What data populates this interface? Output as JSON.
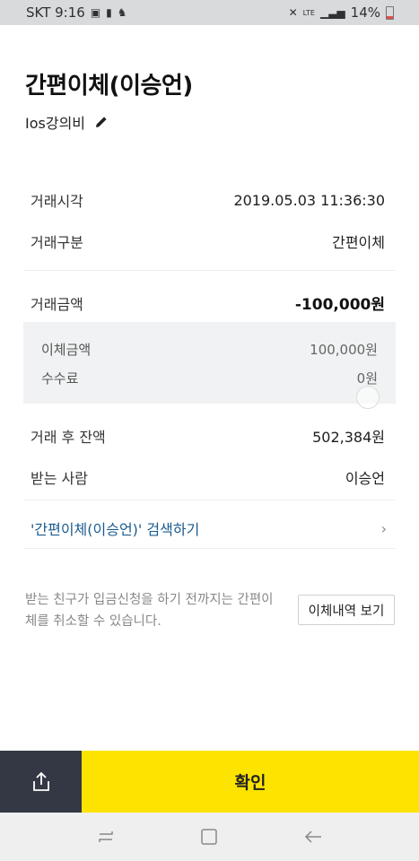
{
  "status_bar": {
    "carrier_time": "SKT 9:16",
    "battery_text": "14%",
    "network": "LTE",
    "icons": [
      "volte-icon",
      "sim-icon",
      "app-icon",
      "mute-icon",
      "signal-icon",
      "battery-icon"
    ]
  },
  "header": {
    "title": "간편이체(이승언)",
    "memo": "Ios강의비"
  },
  "transaction": {
    "time_label": "거래시각",
    "time_value": "2019.05.03 11:36:30",
    "type_label": "거래구분",
    "type_value": "간편이체",
    "amount_label": "거래금액",
    "amount_value": "-100,000원",
    "transfer_label": "이체금액",
    "transfer_value": "100,000원",
    "fee_label": "수수료",
    "fee_value": "0원",
    "balance_label": "거래 후 잔액",
    "balance_value": "502,384원",
    "recipient_label": "받는 사람",
    "recipient_value": "이승언"
  },
  "search_link": {
    "label": "'간편이체(이승언)' 검색하기",
    "chevron": "›"
  },
  "notice": {
    "text": "받는 친구가 입금신청을 하기 전까지는 간편이체를 취소할 수 있습니다.",
    "history_button": "이체내역 보기"
  },
  "actions": {
    "confirm": "확인"
  },
  "colors": {
    "accent_yellow": "#fde400",
    "share_bg": "#333844",
    "link_blue": "#1a5a90"
  }
}
